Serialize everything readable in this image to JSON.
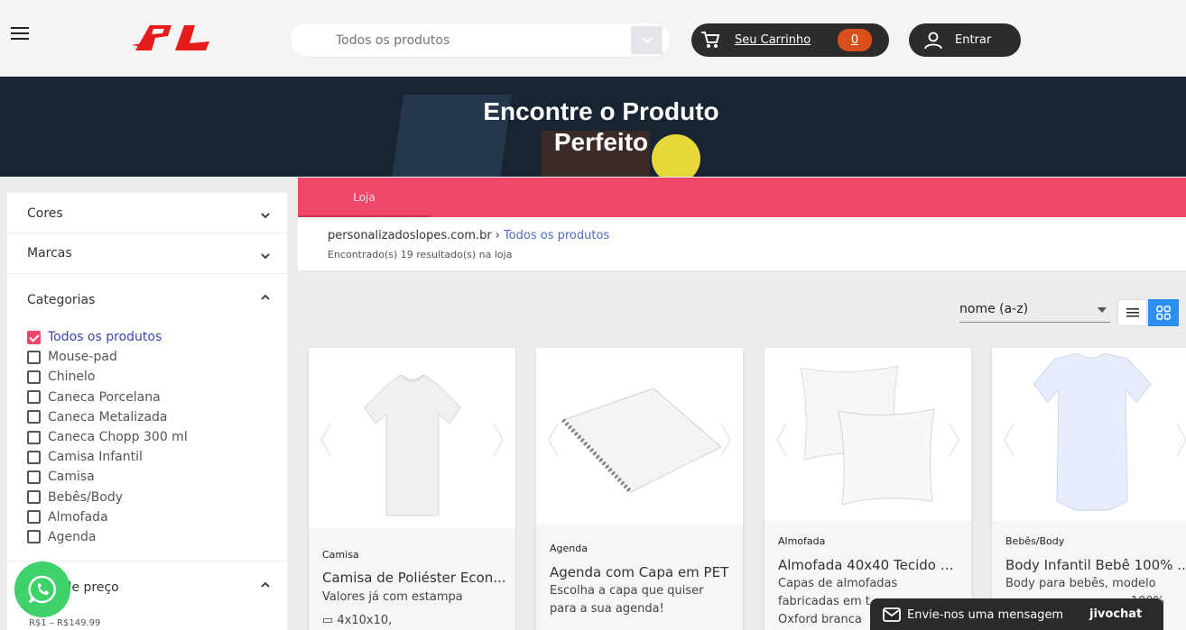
{
  "header": {
    "logo_text": "PL",
    "search": {
      "placeholder": "Todos os produtos"
    },
    "cart": {
      "label": "Seu Carrinho",
      "count": "0"
    },
    "login": {
      "label": "Entrar"
    }
  },
  "hero": {
    "title_line1": "Encontre o Produto",
    "title_line2": "Perfeito"
  },
  "sidebar": {
    "filters": {
      "cores": "Cores",
      "marcas": "Marcas",
      "categorias": "Categorias",
      "faixa_preco": "Faixa de preço"
    },
    "categories": [
      {
        "label": "Todos os produtos",
        "checked": true
      },
      {
        "label": "Mouse-pad",
        "checked": false
      },
      {
        "label": "Chinelo",
        "checked": false
      },
      {
        "label": "Caneca Porcelana",
        "checked": false
      },
      {
        "label": "Caneca Metalizada",
        "checked": false
      },
      {
        "label": "Caneca Chopp 300 ml",
        "checked": false
      },
      {
        "label": "Camisa Infantil",
        "checked": false
      },
      {
        "label": "Camisa",
        "checked": false
      },
      {
        "label": "Bebês/Body",
        "checked": false
      },
      {
        "label": "Almofada",
        "checked": false
      },
      {
        "label": "Agenda",
        "checked": false
      }
    ],
    "price_range": "R$1 – R$149.99"
  },
  "tabs": {
    "loja": "Loja"
  },
  "breadcrumb": {
    "site": "personalizadoslopes.com.br",
    "current": "Todos os produtos",
    "results": "Encontrado(s) 19 resultado(s) na loja"
  },
  "sort": {
    "selected": "nome (a-z)"
  },
  "products": [
    {
      "category": "Camisa",
      "name": "Camisa de Poliéster Econ...",
      "desc1": "Valores já com estampa",
      "desc2": "▭ 4x10x10,"
    },
    {
      "category": "Agenda",
      "name": "Agenda com Capa em PET",
      "desc1": "Escolha a capa que quiser",
      "desc2": "para a sua agenda!"
    },
    {
      "category": "Almofada",
      "name": "Almofada 40x40 Tecido O...",
      "desc1": "Capas de almofadas",
      "desc2": "fabricadas em t...",
      "desc3": "Oxford branca"
    },
    {
      "category": "Bebês/Body",
      "name": "Body Infantil Bebê 100% ...",
      "desc1": "Body para bebês, modelo",
      "desc2": "100%"
    }
  ],
  "chat": {
    "label": "Envie-nos uma mensagem",
    "brand": "jivochat"
  },
  "colors": {
    "accent": "#ef4769",
    "dark": "#2c2c2c",
    "badge": "#d9501c",
    "link": "#4b6bc0",
    "hero": "#182431"
  }
}
